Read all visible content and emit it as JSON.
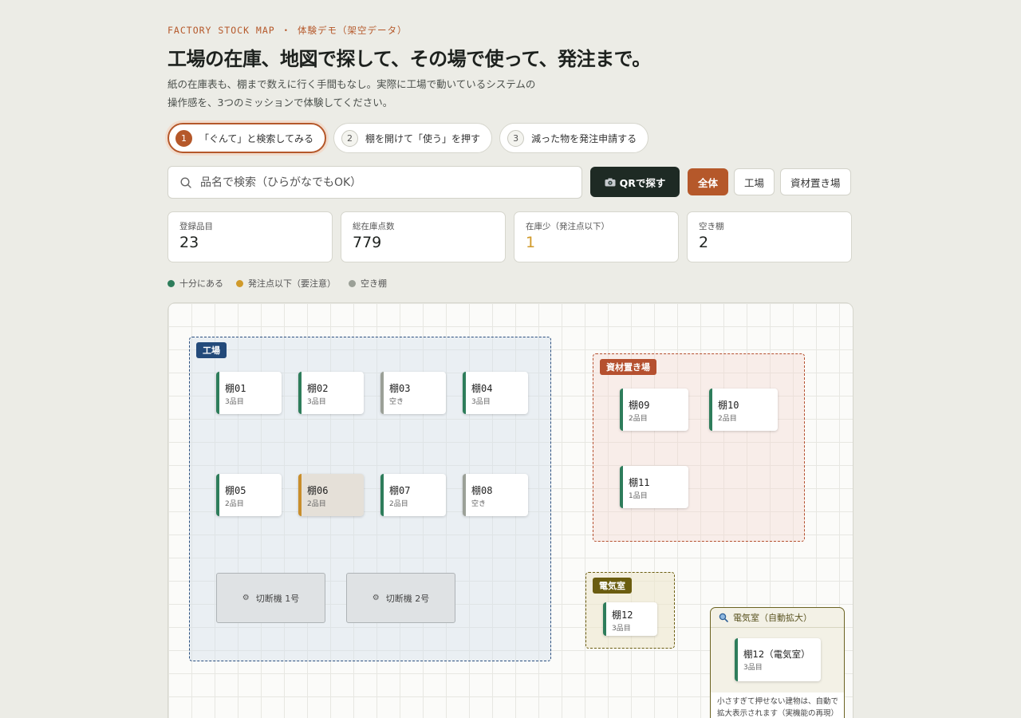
{
  "header": {
    "eyebrow": "FACTORY STOCK MAP ・ 体験デモ（架空データ）",
    "title": "工場の在庫、地図で探して、その場で使って、発注まで。",
    "lead": "紙の在庫表も、棚まで数えに行く手間もなし。実際に工場で動いているシステムの操作感を、3つのミッションで体験してください。"
  },
  "missions": [
    {
      "num": "1",
      "label": "「ぐんて」と検索してみる",
      "active": true
    },
    {
      "num": "2",
      "label": "棚を開けて「使う」を押す",
      "active": false
    },
    {
      "num": "3",
      "label": "減った物を発注申請する",
      "active": false
    }
  ],
  "search": {
    "placeholder": "品名で検索（ひらがなでもOK）",
    "value": ""
  },
  "qr_button": {
    "icon": "camera-icon",
    "label": "QRで探す"
  },
  "filters": [
    {
      "label": "全体",
      "active": true
    },
    {
      "label": "工場",
      "active": false
    },
    {
      "label": "資材置き場",
      "active": false
    }
  ],
  "stats": [
    {
      "label": "登録品目",
      "value": "23"
    },
    {
      "label": "総在庫点数",
      "value": "779"
    },
    {
      "label": "在庫少（発注点以下）",
      "value": "1"
    },
    {
      "label": "空き棚",
      "value": "2"
    }
  ],
  "legend": [
    {
      "label": "十分にある",
      "color": "#2e7d5b"
    },
    {
      "label": "発注点以下（要注意）",
      "color": "#d09a2a"
    },
    {
      "label": "空き棚",
      "color": "#9ba097"
    }
  ],
  "colors": {
    "accent": "#b5582a",
    "ok": "#2e7d5b",
    "low": "#c98e2c",
    "empty": "#9ba097",
    "factory_zone": "#234a7a",
    "materials_zone": "#b5502f",
    "electric_zone": "#6b5d10"
  },
  "map": {
    "zones": {
      "factory": {
        "label": "工場"
      },
      "materials": {
        "label": "資材置き場"
      },
      "electric": {
        "label": "電気室"
      }
    },
    "shelves": [
      {
        "name": "棚01",
        "sub": "3品目",
        "status": "ok"
      },
      {
        "name": "棚02",
        "sub": "3品目",
        "status": "ok"
      },
      {
        "name": "棚03",
        "sub": "空き",
        "status": "empty"
      },
      {
        "name": "棚04",
        "sub": "3品目",
        "status": "ok"
      },
      {
        "name": "棚05",
        "sub": "2品目",
        "status": "ok"
      },
      {
        "name": "棚06",
        "sub": "2品目",
        "status": "low"
      },
      {
        "name": "棚07",
        "sub": "2品目",
        "status": "ok"
      },
      {
        "name": "棚08",
        "sub": "空き",
        "status": "empty"
      },
      {
        "name": "棚09",
        "sub": "2品目",
        "status": "ok"
      },
      {
        "name": "棚10",
        "sub": "2品目",
        "status": "ok"
      },
      {
        "name": "棚11",
        "sub": "1品目",
        "status": "ok"
      },
      {
        "name": "棚12",
        "sub": "3品目",
        "status": "ok"
      }
    ],
    "machines": [
      {
        "label": "切断機 1号"
      },
      {
        "label": "切断機 2号"
      }
    ],
    "zoom_panel": {
      "title": "電気室（自動拡大）",
      "shelf_name": "棚12（電気室）",
      "shelf_sub": "3品目",
      "note": "小さすぎて押せない建物は、自動で拡大表示されます（実機能の再現）"
    }
  }
}
